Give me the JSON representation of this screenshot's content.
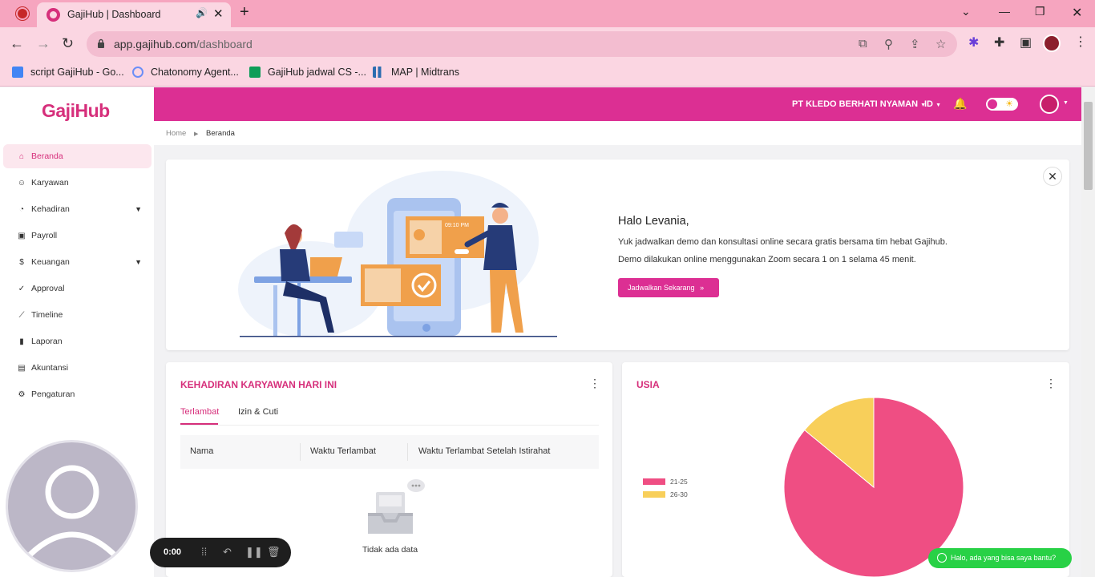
{
  "browser": {
    "tab_title": "GajiHub | Dashboard",
    "url_host": "app.gajihub.com",
    "url_path": "/dashboard",
    "bookmarks": [
      {
        "label": "script GajiHub - Go...",
        "color": "#4285f4"
      },
      {
        "label": "Chatonomy Agent...",
        "color": "#6b8ef7"
      },
      {
        "label": "GajiHub jadwal CS -...",
        "color": "#0f9d58"
      },
      {
        "label": "MAP | Midtrans",
        "color": "#2b6cb0"
      }
    ]
  },
  "brand": {
    "logo": "GajiHub",
    "accent": "#dc2f93"
  },
  "sidebar": {
    "items": [
      {
        "label": "Beranda",
        "icon": "home-icon",
        "active": true
      },
      {
        "label": "Karyawan",
        "icon": "people-icon"
      },
      {
        "label": "Kehadiran",
        "icon": "clock-icon",
        "expandable": true
      },
      {
        "label": "Payroll",
        "icon": "payroll-icon"
      },
      {
        "label": "Keuangan",
        "icon": "money-icon",
        "expandable": true
      },
      {
        "label": "Approval",
        "icon": "check-circle-icon"
      },
      {
        "label": "Timeline",
        "icon": "trend-icon"
      },
      {
        "label": "Laporan",
        "icon": "bar-chart-icon"
      },
      {
        "label": "Akuntansi",
        "icon": "ledger-icon"
      },
      {
        "label": "Pengaturan",
        "icon": "gear-icon"
      }
    ]
  },
  "topbar": {
    "company": "PT KLEDO BERHATI NYAMAN",
    "lang": "ID"
  },
  "breadcrumb": {
    "home": "Home",
    "current": "Beranda"
  },
  "banner": {
    "greeting": "Halo Levania,",
    "line1": "Yuk jadwalkan demo dan konsultasi online secara gratis bersama tim hebat Gajihub.",
    "line2": "Demo dilakukan online menggunakan Zoom secara 1 on 1 selama 45 menit.",
    "cta": "Jadwalkan Sekarang",
    "illus_time": "09:10 PM"
  },
  "attendance": {
    "title": "KEHADIRAN KARYAWAN HARI INI",
    "tabs": [
      "Terlambat",
      "Izin & Cuti"
    ],
    "columns": [
      "Nama",
      "Waktu Terlambat",
      "Waktu Terlambat Setelah Istirahat"
    ],
    "empty": "Tidak ada data"
  },
  "usia": {
    "title": "USIA"
  },
  "chart_data": {
    "type": "pie",
    "title": "USIA",
    "categories": [
      "21-25",
      "26-30"
    ],
    "values": [
      86,
      14
    ],
    "colors": [
      "#ef4e83",
      "#f8cf5a"
    ],
    "legend_position": "left"
  },
  "recorder": {
    "time": "0:00"
  },
  "whatsapp": {
    "label": "Halo, ada yang bisa saya bantu?"
  }
}
